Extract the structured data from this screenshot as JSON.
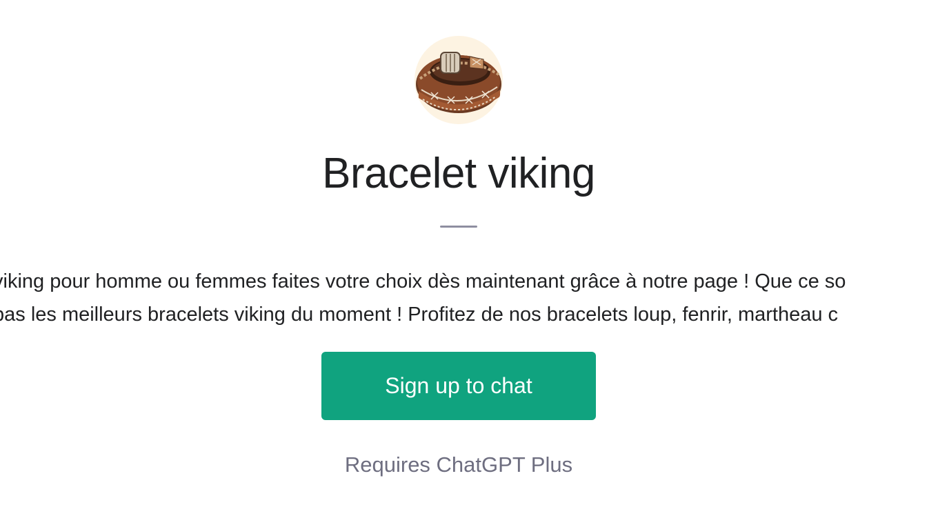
{
  "gpt": {
    "avatar_icon": "viking-bracelet-image",
    "title": "Bracelet viking",
    "description_line1": "viking pour homme ou femmes faites votre choix dès maintenant grâce à notre page ! Que ce so",
    "description_line2": "pas les meilleurs bracelets viking du moment ! Profitez de nos bracelets loup, fenrir, martheau c"
  },
  "cta": {
    "label": "Sign up to chat"
  },
  "footer": {
    "requires_text": "Requires ChatGPT Plus"
  },
  "colors": {
    "accent": "#10a37f",
    "title": "#202123",
    "muted": "#6e6e80",
    "avatar_bg": "#fdf3e2"
  }
}
